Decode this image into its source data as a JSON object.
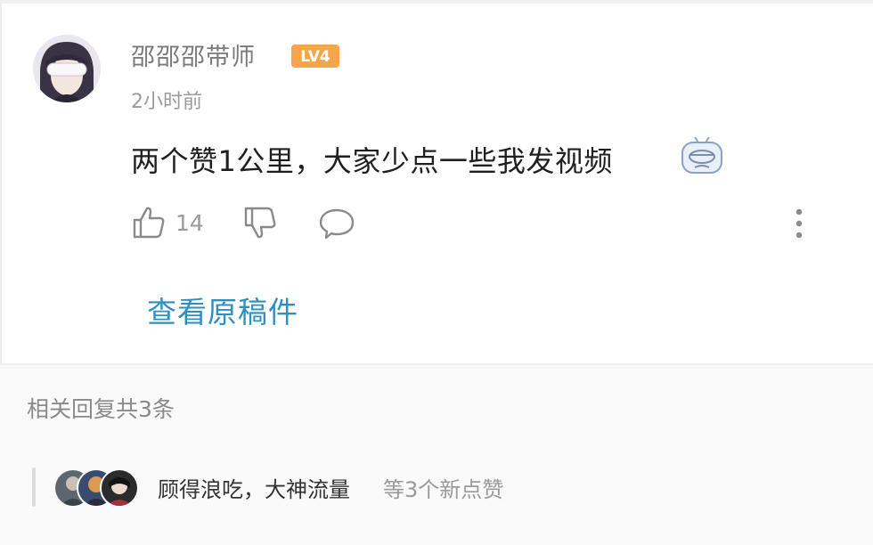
{
  "comment": {
    "username": "邵邵邵带师",
    "level_badge": "LV4",
    "time": "2小时前",
    "text": "两个赞1公里，大家少点一些我发视频",
    "like_count": "14",
    "view_original_label": "查看原稿件"
  },
  "replies": {
    "summary": "相关回复共3条",
    "liker_names": "顾得浪吃，大神流量",
    "liker_suffix": "等3个新点赞"
  },
  "colors": {
    "level_badge": "#f7a54a",
    "link": "#2f8fbf",
    "muted": "#9b9b9b"
  },
  "icons": [
    "thumbs-up-icon",
    "thumbs-down-icon",
    "reply-bubble-icon",
    "more-vertical-icon",
    "tv-emoji-icon"
  ]
}
